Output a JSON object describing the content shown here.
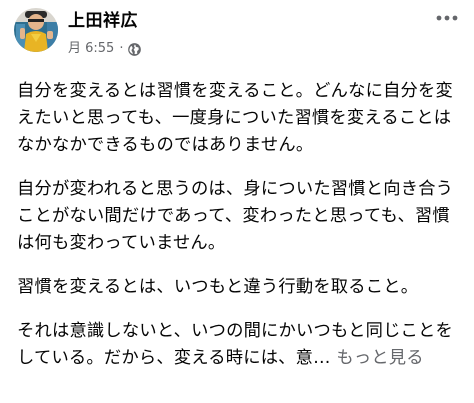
{
  "post": {
    "author": "上田祥広",
    "time": "月 6:55",
    "separator": "·",
    "privacy_icon": "globe-icon",
    "menu_icon": "more-horizontal-icon",
    "paragraphs": [
      "自分を変えるとは習慣を変えること。どんなに自分を変えたいと思っても、一度身についた習慣を変えることはなかなかできるものではありません。",
      "自分が変われると思うのは、身についた習慣と向き合うことがない間だけであって、変わったと思っても、習慣は何も変わっていません。",
      "習慣を変えるとは、いつもと違う行動を取ること。",
      "それは意識しないと、いつの間にかいつもと同じことをしている。だから、変える時には、意…"
    ],
    "see_more": "もっと見る"
  },
  "colors": {
    "text": "#050505",
    "secondary": "#65676b",
    "background": "#ffffff"
  }
}
